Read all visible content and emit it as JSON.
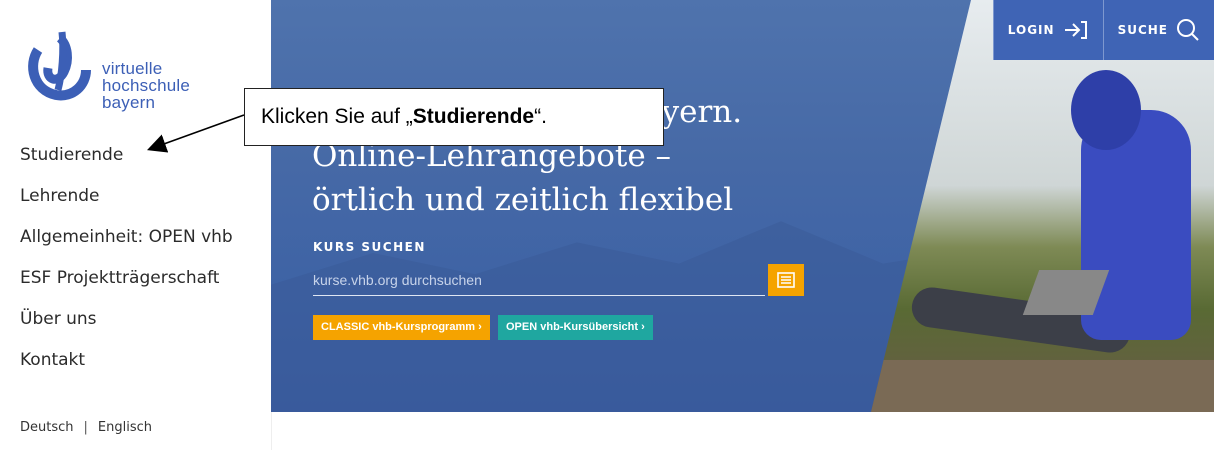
{
  "logo": {
    "line1": "virtuelle",
    "line2": "hochschule",
    "line3": "bayern",
    "color": "#3c5fb6"
  },
  "nav": [
    {
      "label": "Studierende"
    },
    {
      "label": "Lehrende"
    },
    {
      "label": "Allgemeinheit: OPEN vhb"
    },
    {
      "label": "ESF Projektträgerschaft"
    },
    {
      "label": "Über uns"
    },
    {
      "label": "Kontakt"
    }
  ],
  "lang": {
    "de": "Deutsch",
    "sep": "|",
    "en": "Englisch"
  },
  "topbar": {
    "login": "LOGIN",
    "search": "SUCHE",
    "color": "#3f64b5"
  },
  "hero": {
    "line1": "Online-Hochschule Bayern.",
    "line2": "Online-Lehrangebote –",
    "line3": "örtlich und zeitlich flexibel",
    "search_label": "KURS SUCHEN",
    "search_placeholder": "kurse.vhb.org durchsuchen",
    "btn_classic": "CLASSIC vhb-Kursprogramm",
    "btn_open": "OPEN vhb-Kursübersicht",
    "chevron": "›",
    "accent_orange": "#f5a300",
    "accent_teal": "#1fa7a0"
  },
  "callout": {
    "prefix": "Klicken Sie auf „",
    "bold": "Studierende",
    "suffix": "“."
  }
}
